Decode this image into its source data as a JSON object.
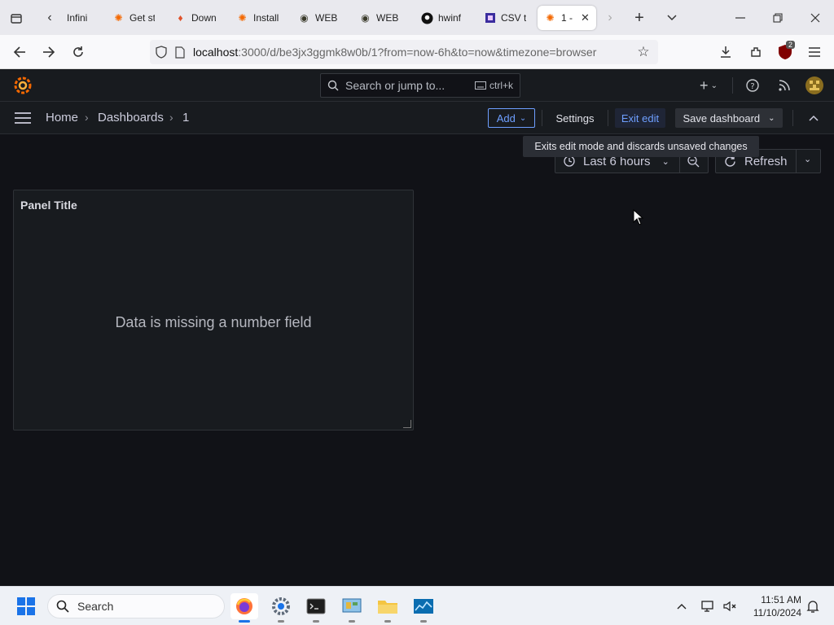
{
  "browser": {
    "tabs": [
      {
        "label": "Infini",
        "icon": "page-icon"
      },
      {
        "label": "Get st",
        "icon": "grafana-icon"
      },
      {
        "label": "Down",
        "icon": "flame-icon"
      },
      {
        "label": "Install",
        "icon": "grafana-icon"
      },
      {
        "label": "WEB",
        "icon": "eye-icon"
      },
      {
        "label": "WEB",
        "icon": "eye-icon"
      },
      {
        "label": "hwinf",
        "icon": "github-icon"
      },
      {
        "label": "CSV t",
        "icon": "puzzle-icon"
      },
      {
        "label": "1 -",
        "icon": "grafana-icon",
        "active": true
      }
    ],
    "url_host": "localhost",
    "url_path": ":3000/d/be3jx3ggmk8w0b/1?from=now-6h&to=now&timezone=browser",
    "extension_badge": "2"
  },
  "grafana": {
    "search_placeholder": "Search or jump to...",
    "search_shortcut": "ctrl+k",
    "breadcrumbs": [
      "Home",
      "Dashboards",
      "1"
    ],
    "add_label": "Add",
    "settings_label": "Settings",
    "exit_edit_label": "Exit edit",
    "save_label": "Save dashboard",
    "tooltip": "Exits edit mode and discards unsaved changes",
    "time_range": "Last 6 hours",
    "refresh_label": "Refresh",
    "panel": {
      "title": "Panel Title",
      "message": "Data is missing a number field"
    }
  },
  "taskbar": {
    "search_label": "Search",
    "time": "11:51 AM",
    "date": "11/10/2024"
  },
  "colors": {
    "accent": "#6e9fff",
    "grafana_orange": "#f46800",
    "bg": "#111217"
  }
}
